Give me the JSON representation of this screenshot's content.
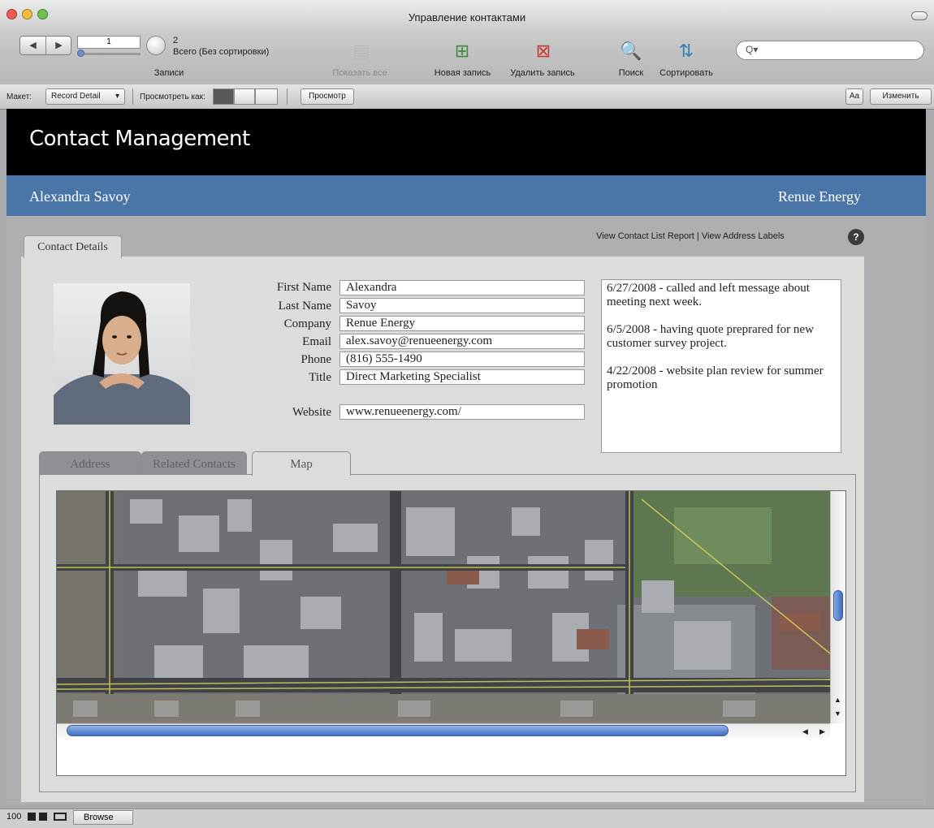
{
  "window": {
    "title": "Управление контактами"
  },
  "toolbar": {
    "record_number": "1",
    "total_count": "2",
    "total_label": "Всего (Без сортировки)",
    "records_label": "Записи",
    "show_all": "Показать все",
    "new_record": "Новая запись",
    "delete_record": "Удалить запись",
    "find": "Поиск",
    "sort": "Сортировать",
    "search_value": ""
  },
  "statusbar": {
    "layout_label": "Макет:",
    "layout_value": "Record Detail",
    "view_as_label": "Просмотреть как:",
    "preview_button": "Просмотр",
    "format_button": "Aa",
    "edit_button": "Изменить"
  },
  "layout": {
    "app_title": "Contact Management",
    "contact_name": "Alexandra Savoy",
    "company_name": "Renue Energy",
    "link_list_report": "View Contact List Report",
    "link_separator": "|",
    "link_address_labels": "View Address Labels",
    "help": "?",
    "tab_contact_details": "Contact Details"
  },
  "fields": [
    {
      "label": "First Name",
      "value": "Alexandra"
    },
    {
      "label": "Last Name",
      "value": "Savoy"
    },
    {
      "label": "Company",
      "value": "Renue Energy"
    },
    {
      "label": "Email",
      "value": "alex.savoy@renueenergy.com"
    },
    {
      "label": "Phone",
      "value": "(816) 555-1490"
    },
    {
      "label": "Title",
      "value": "Direct Marketing Specialist"
    },
    {
      "label": "Website",
      "value": "www.renueenergy.com/"
    }
  ],
  "notes": [
    "6/27/2008 - called and left message about meeting next week.",
    "6/5/2008 - having quote preprared for new customer survey project.",
    "4/22/2008 - website plan review for summer promotion"
  ],
  "subtabs": {
    "address": "Address",
    "related": "Related Contacts",
    "map": "Map"
  },
  "footer": {
    "zoom": "100",
    "mode": "Browse"
  }
}
